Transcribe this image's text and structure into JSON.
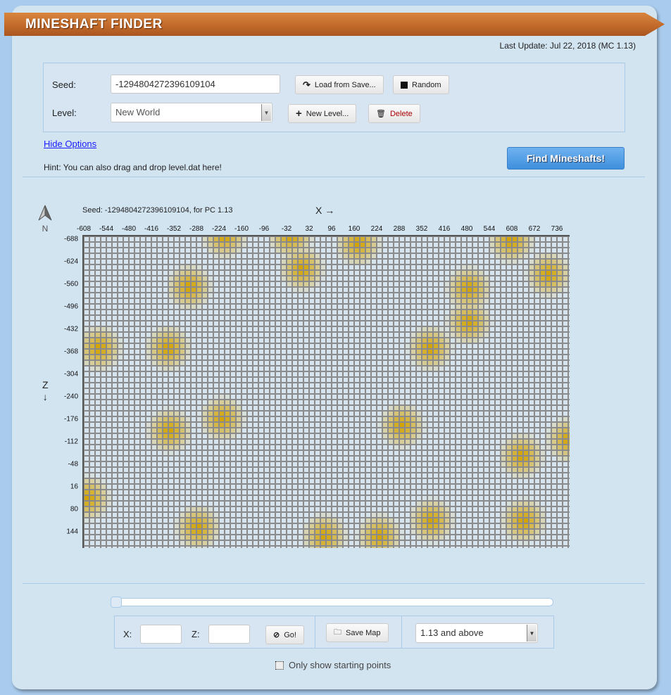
{
  "header": {
    "title": "MINESHAFT FINDER",
    "last_update": "Last Update: Jul 22, 2018 (MC 1.13)"
  },
  "options": {
    "seed_label": "Seed:",
    "seed_value": "-1294804272396109104",
    "load_from_save": "Load from Save...",
    "random": "Random",
    "level_label": "Level:",
    "level_value": "New World",
    "new_level": "New Level...",
    "delete": "Delete",
    "hide_options": "Hide Options",
    "hint": "Hint: You can also drag and drop level.dat here!",
    "find_button": "Find Mineshafts!"
  },
  "map": {
    "caption": "Seed: -1294804272396109104, for PC 1.13",
    "compass": "N",
    "x_axis": "X →",
    "z_axis": "Z",
    "z_arrow": "↓",
    "x_ticks": [
      "-608",
      "-544",
      "-480",
      "-416",
      "-352",
      "-288",
      "-224",
      "-160",
      "-96",
      "-32",
      "32",
      "96",
      "160",
      "224",
      "288",
      "352",
      "416",
      "480",
      "544",
      "608",
      "672",
      "736"
    ],
    "z_ticks": [
      "-688",
      "-624",
      "-560",
      "-496",
      "-432",
      "-368",
      "-304",
      "-240",
      "-176",
      "-112",
      "-48",
      "16",
      "80",
      "144"
    ],
    "colors": {
      "empty": "#d7e4ee",
      "grid": "#8a8a8a",
      "mineshaft": "#d4a300"
    },
    "mineshafts": [
      [
        -308,
        -544
      ],
      [
        12,
        -596
      ],
      [
        172,
        -668
      ],
      [
        606,
        -676
      ],
      [
        712,
        -580
      ],
      [
        486,
        -540
      ],
      [
        486,
        -444
      ],
      [
        -564,
        -370
      ],
      [
        -368,
        -370
      ],
      [
        376,
        -370
      ],
      [
        -214,
        -170
      ],
      [
        -364,
        -136
      ],
      [
        296,
        -150
      ],
      [
        636,
        -64
      ],
      [
        770,
        -110
      ],
      [
        -596,
        56
      ],
      [
        -284,
        140
      ],
      [
        76,
        164
      ],
      [
        232,
        164
      ],
      [
        380,
        120
      ],
      [
        642,
        120
      ],
      [
        -208,
        -690
      ],
      [
        -20,
        -690
      ]
    ]
  },
  "controls": {
    "slider_value": 0,
    "x_label": "X:",
    "z_label": "Z:",
    "x_value": "",
    "z_value": "",
    "go": "Go!",
    "save_map": "Save Map",
    "version_value": "1.13 and above",
    "only_starting_points": "Only show starting points",
    "only_starting_checked": false
  }
}
